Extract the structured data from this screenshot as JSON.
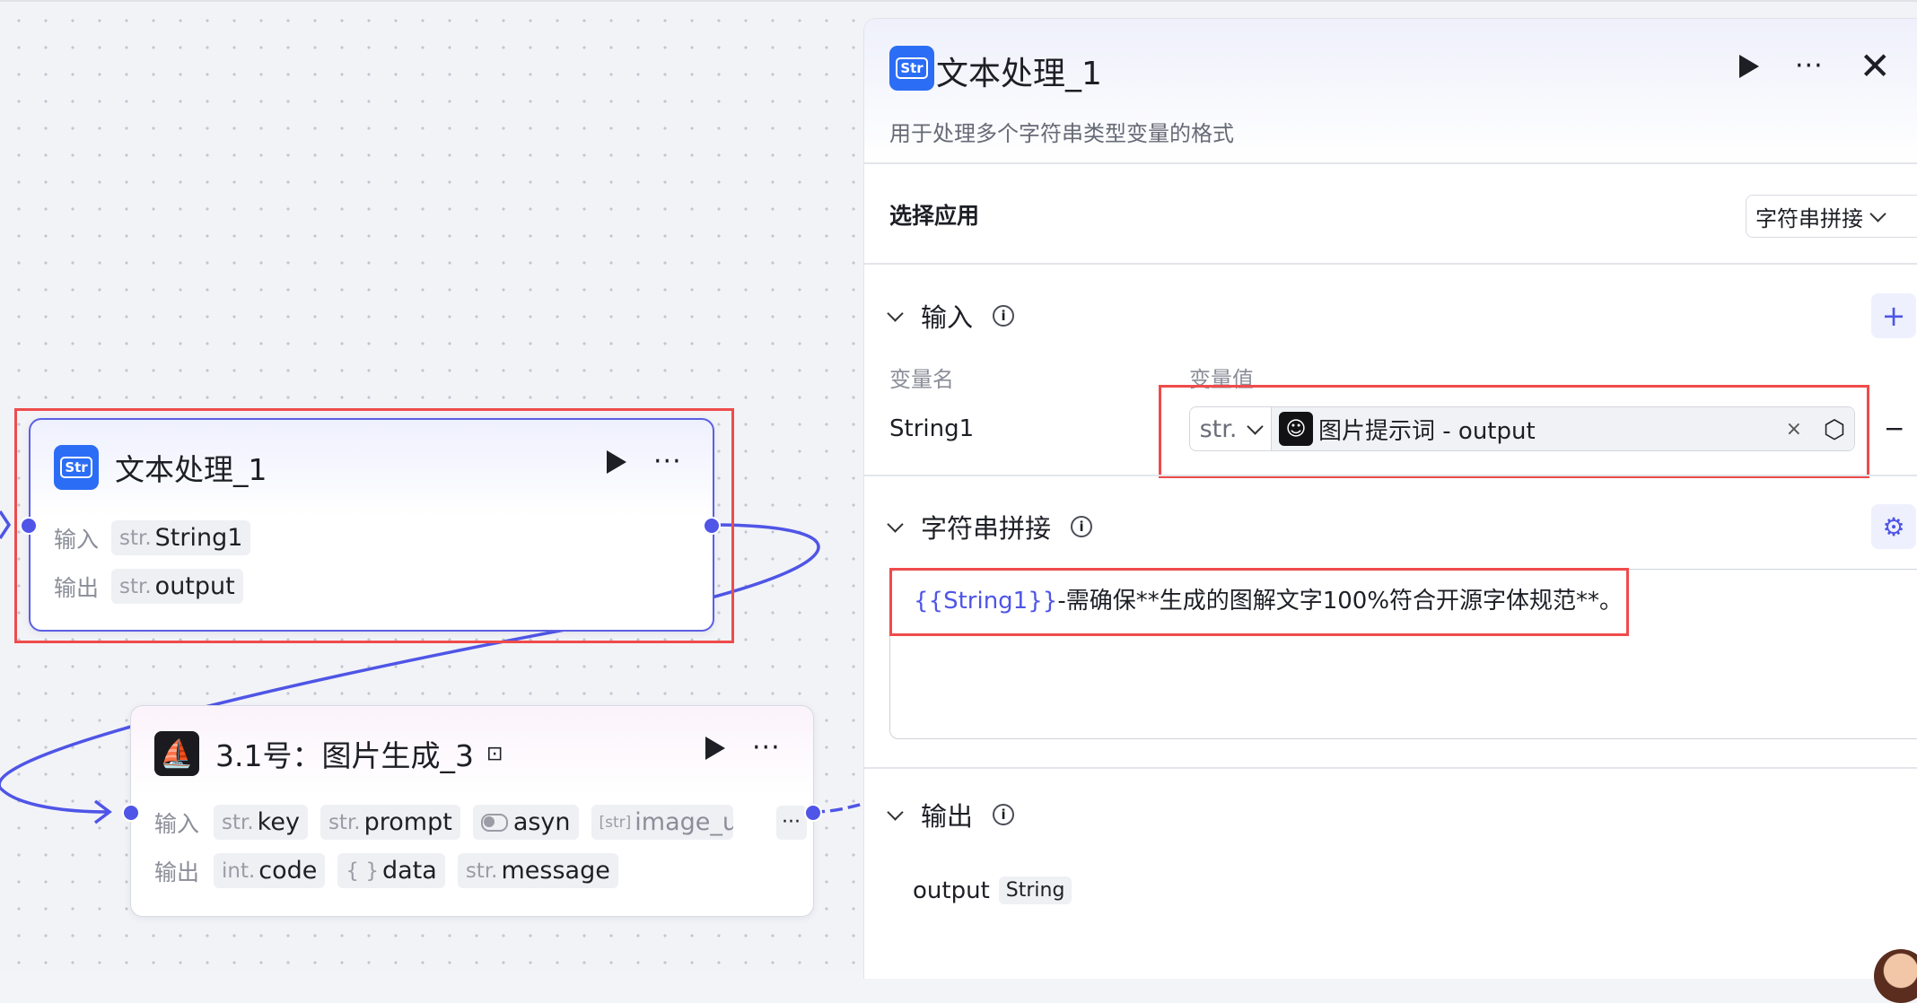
{
  "colors": {
    "accent": "#4f55e6",
    "highlight": "#ef4b4b",
    "str_icon_bg": "#2b6df5"
  },
  "canvas": {
    "node1": {
      "icon": "str-plugin-icon",
      "icon_text": "Str",
      "title": "文本处理_1",
      "input_label": "输入",
      "output_label": "输出",
      "inputs": [
        {
          "type": "str.",
          "name": "String1"
        }
      ],
      "outputs": [
        {
          "type": "str.",
          "name": "output"
        }
      ]
    },
    "node2": {
      "icon": "image-gen-icon",
      "title": "3.1号：图片生成_3",
      "input_label": "输入",
      "output_label": "输出",
      "inputs": [
        {
          "type": "str.",
          "name": "key"
        },
        {
          "type": "str.",
          "name": "prompt"
        },
        {
          "type": "toggle",
          "name": "asyn"
        },
        {
          "type": "[str]",
          "name": "image_url"
        }
      ],
      "more": "···",
      "outputs": [
        {
          "type": "int.",
          "name": "code"
        },
        {
          "type": "{ }",
          "name": "data"
        },
        {
          "type": "str.",
          "name": "message"
        }
      ]
    }
  },
  "panel": {
    "title": "文本处理_1",
    "icon_text": "Str",
    "description": "用于处理多个字符串类型变量的格式",
    "select_app_label": "选择应用",
    "select_app_value": "字符串拼接",
    "input_section": {
      "title": "输入",
      "col_name": "变量名",
      "col_value": "变量值",
      "var_name": "String1",
      "var_type": "str.",
      "var_ref": "图片提示词 - output"
    },
    "concat_section": {
      "title": "字符串拼接",
      "template_var": "{{String1}}",
      "template_text": "-需确保**生成的图解文字100%符合开源字体规范**。"
    },
    "output_section": {
      "title": "输出",
      "name": "output",
      "type": "String"
    }
  }
}
